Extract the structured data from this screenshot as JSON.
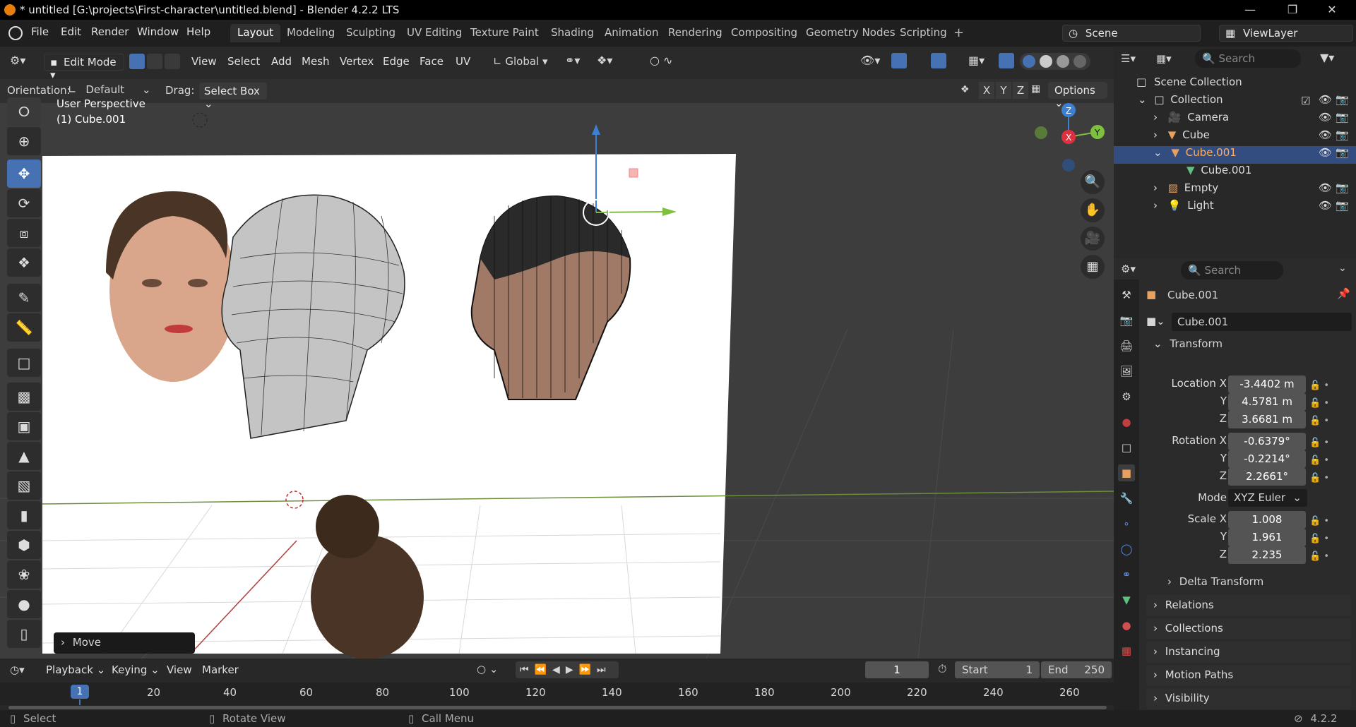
{
  "window": {
    "title": "* untitled [G:\\projects\\First-character\\untitled.blend] - Blender 4.2.2 LTS"
  },
  "menu": {
    "items": [
      "File",
      "Edit",
      "Render",
      "Window",
      "Help"
    ]
  },
  "workspaces": [
    "Layout",
    "Modeling",
    "Sculpting",
    "UV Editing",
    "Texture Paint",
    "Shading",
    "Animation",
    "Rendering",
    "Compositing",
    "Geometry Nodes",
    "Scripting"
  ],
  "scene": {
    "name": "Scene",
    "view_layer": "ViewLayer"
  },
  "viewport": {
    "mode": "Edit Mode",
    "menus": [
      "View",
      "Select",
      "Add",
      "Mesh",
      "Vertex",
      "Edge",
      "Face",
      "UV"
    ],
    "transform_space": "Global",
    "orientation_label": "Orientation:",
    "orientation_value": "Default",
    "drag_label": "Drag:",
    "drag_value": "Select Box",
    "axes": [
      "X",
      "Y",
      "Z"
    ],
    "options": "Options",
    "perspective": "User Perspective",
    "object_info": "(1) Cube.001",
    "operator_panel": "Move"
  },
  "outliner": {
    "search_placeholder": "Search",
    "scene_collection": "Scene Collection",
    "collection": "Collection",
    "items": [
      "Camera",
      "Cube",
      "Cube.001",
      "Cube.001",
      "Empty",
      "Light"
    ]
  },
  "properties": {
    "search_placeholder": "Search",
    "object_name": "Cube.001",
    "data_name": "Cube.001",
    "transform_title": "Transform",
    "location_label": "Location X",
    "rotation_label": "Rotation X",
    "scale_label": "Scale X",
    "y_label": "Y",
    "z_label": "Z",
    "location": [
      "-3.4402 m",
      "4.5781 m",
      "3.6681 m"
    ],
    "rotation": [
      "-0.6379°",
      "-0.2214°",
      "2.2661°"
    ],
    "mode_label": "Mode",
    "mode_value": "XYZ Euler",
    "scale": [
      "1.008",
      "1.961",
      "2.235"
    ],
    "delta_transform": "Delta Transform",
    "panels": [
      "Relations",
      "Collections",
      "Instancing",
      "Motion Paths",
      "Visibility"
    ]
  },
  "timeline": {
    "menus": [
      "Playback",
      "Keying",
      "View",
      "Marker"
    ],
    "current_frame": "1",
    "start_label": "Start",
    "start": "1",
    "end_label": "End",
    "end": "250",
    "ticks": [
      "1",
      "20",
      "40",
      "60",
      "80",
      "100",
      "120",
      "140",
      "160",
      "180",
      "200",
      "220",
      "240",
      "260"
    ]
  },
  "status": {
    "select": "Select",
    "rotate": "Rotate View",
    "call_menu": "Call Menu",
    "version": "4.2.2"
  }
}
